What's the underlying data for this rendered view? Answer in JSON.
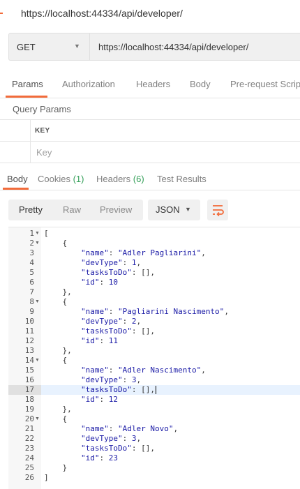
{
  "request": {
    "title": "https://localhost:44334/api/developer/",
    "method": "GET",
    "url": "https://localhost:44334/api/developer/"
  },
  "request_tabs": [
    {
      "label": "Params",
      "active": true
    },
    {
      "label": "Authorization",
      "active": false
    },
    {
      "label": "Headers",
      "active": false
    },
    {
      "label": "Body",
      "active": false
    },
    {
      "label": "Pre-request Script",
      "active": false
    }
  ],
  "query_params": {
    "section_title": "Query Params",
    "key_header": "KEY",
    "key_placeholder": "Key"
  },
  "response_tabs": {
    "body": "Body",
    "cookies": "Cookies",
    "cookies_count": "(1)",
    "headers": "Headers",
    "headers_count": "(6)",
    "test_results": "Test Results"
  },
  "body_view": {
    "modes": [
      "Pretty",
      "Raw",
      "Preview"
    ],
    "active_mode": "Pretty",
    "format": "JSON",
    "wrap_icon": "wrap-lines-icon"
  },
  "colors": {
    "accent": "#f26b3a",
    "count": "#36a05a",
    "json_value": "#1a1aa6"
  },
  "response_body": [
    {
      "no": "1",
      "text": "[",
      "fold": true
    },
    {
      "no": "2",
      "text": "    {",
      "fold": true
    },
    {
      "no": "3",
      "text": "        \"name\": \"Adler Pagliarini\","
    },
    {
      "no": "4",
      "text": "        \"devType\": 1,"
    },
    {
      "no": "5",
      "text": "        \"tasksToDo\": [],"
    },
    {
      "no": "6",
      "text": "        \"id\": 10"
    },
    {
      "no": "7",
      "text": "    },"
    },
    {
      "no": "8",
      "text": "    {",
      "fold": true
    },
    {
      "no": "9",
      "text": "        \"name\": \"Pagliarini Nascimento\","
    },
    {
      "no": "10",
      "text": "        \"devType\": 2,"
    },
    {
      "no": "11",
      "text": "        \"tasksToDo\": [],"
    },
    {
      "no": "12",
      "text": "        \"id\": 11"
    },
    {
      "no": "13",
      "text": "    },"
    },
    {
      "no": "14",
      "text": "    {",
      "fold": true
    },
    {
      "no": "15",
      "text": "        \"name\": \"Adler Nascimento\","
    },
    {
      "no": "16",
      "text": "        \"devType\": 3,"
    },
    {
      "no": "17",
      "text": "        \"tasksToDo\": [],",
      "highlighted": true,
      "cursor": true
    },
    {
      "no": "18",
      "text": "        \"id\": 12"
    },
    {
      "no": "19",
      "text": "    },"
    },
    {
      "no": "20",
      "text": "    {",
      "fold": true
    },
    {
      "no": "21",
      "text": "        \"name\": \"Adler Novo\","
    },
    {
      "no": "22",
      "text": "        \"devType\": 3,"
    },
    {
      "no": "23",
      "text": "        \"tasksToDo\": [],"
    },
    {
      "no": "24",
      "text": "        \"id\": 23"
    },
    {
      "no": "25",
      "text": "    }"
    },
    {
      "no": "26",
      "text": "]"
    }
  ]
}
